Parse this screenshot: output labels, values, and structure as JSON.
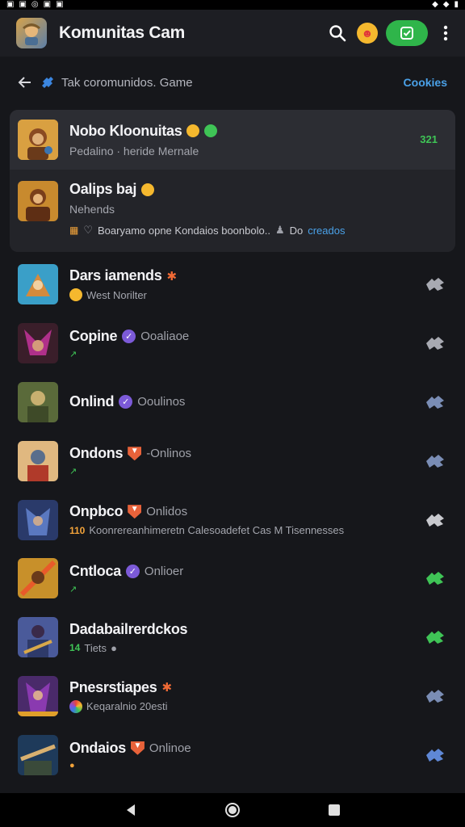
{
  "status_bar": {
    "left_icons": [
      "notif-icon",
      "notif-icon",
      "sync-icon",
      "image-icon",
      "image-icon"
    ],
    "right_icons": [
      "signal-icon",
      "wifi-icon",
      "battery-icon"
    ]
  },
  "app_bar": {
    "title": "Komunitas Cam",
    "accent": "#2fb54a"
  },
  "breadcrumb": {
    "text": "Tak coromunidos. Game",
    "link": "Cookies"
  },
  "pinned": [
    {
      "name": "Nobo Kloonuitas",
      "sub": "Pedalino  ·  heride Mernale",
      "count": "321",
      "emoji": "smile"
    },
    {
      "name": "Oalips baj",
      "sub": "Nehends",
      "line2": "Boaryamo opne Kondaios boonbolo..",
      "line2_tail": "Do",
      "line2_link": "creados"
    }
  ],
  "rows": [
    {
      "name": "Dars iamends",
      "badge": "star",
      "status": "",
      "sub": "West Norilter",
      "sub_icon": "emoji",
      "action_color": "#a8aab2"
    },
    {
      "name": "Copine",
      "badge": "verified",
      "status": "Ooaliaoe",
      "sub": "",
      "sub_icon": "dot",
      "action_color": "#a8aab2"
    },
    {
      "name": "Onlind",
      "badge": "verified",
      "status": "Ooulinos",
      "sub": "",
      "sub_icon": "",
      "action_color": "#7a8db5"
    },
    {
      "name": "Ondons",
      "badge": "shield",
      "status": "-Onlinos",
      "sub": "",
      "sub_icon": "dot",
      "action_color": "#7a8db5"
    },
    {
      "name": "Onpbco",
      "badge": "shield",
      "status": "Onlidos",
      "sub": "Koonrereanhimeretn Calesoadefet Cas M Tisennesses",
      "sub_icon": "tag",
      "sub_tag": "110",
      "action_color": "#c8c9ce"
    },
    {
      "name": "Cntloca",
      "badge": "verified",
      "status": "Onlioer",
      "sub": "",
      "sub_icon": "dot",
      "action_color": "#3fc456"
    },
    {
      "name": "Dadabailrerdckos",
      "badge": "",
      "status": "",
      "sub": "Tiets",
      "sub_icon": "tag-green",
      "sub_tag": "14",
      "action_color": "#3fc456"
    },
    {
      "name": "Pnesrstiapes",
      "badge": "star",
      "status": "",
      "sub": "Keqaralnio 20esti",
      "sub_icon": "ball",
      "action_color": "#7a8db5"
    },
    {
      "name": "Ondaios",
      "badge": "shield",
      "status": "Onlinoe",
      "sub": "",
      "sub_icon": "dot-orange",
      "action_color": "#5f88d6"
    }
  ],
  "nav": {
    "back": "back-icon",
    "home": "home-icon",
    "recents": "recents-icon"
  }
}
